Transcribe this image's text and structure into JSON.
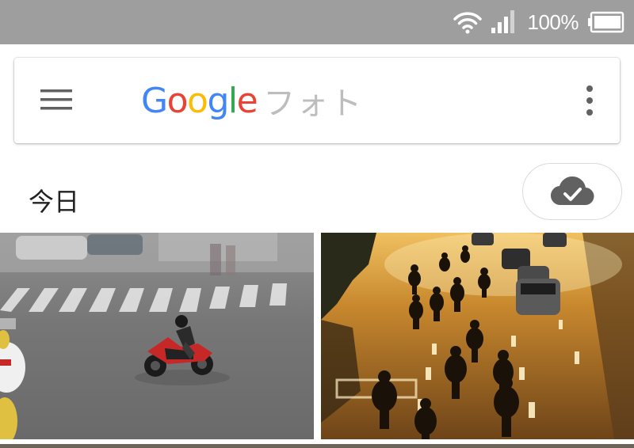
{
  "status_bar": {
    "battery_percent": "100%",
    "icons": [
      "wifi-icon",
      "cell-signal-icon",
      "battery-icon"
    ]
  },
  "search_bar": {
    "menu_icon": "hamburger-menu-icon",
    "logo_text": "Google",
    "product_name": "フォト",
    "more_icon": "more-vertical-icon",
    "logo_colors": [
      "#4285F4",
      "#EA4335",
      "#FBBC05",
      "#4285F4",
      "#34A853",
      "#EA4335"
    ]
  },
  "section": {
    "title": "今日",
    "backup_icon": "cloud-check-icon"
  },
  "photos": [
    {
      "name": "motorcycle-crosswalk"
    },
    {
      "name": "scooters-sunset-street"
    }
  ],
  "colors": {
    "status_bar_bg": "#9e9e9e",
    "icon_gray": "#616161",
    "placeholder_gray": "#bdbdbd"
  }
}
